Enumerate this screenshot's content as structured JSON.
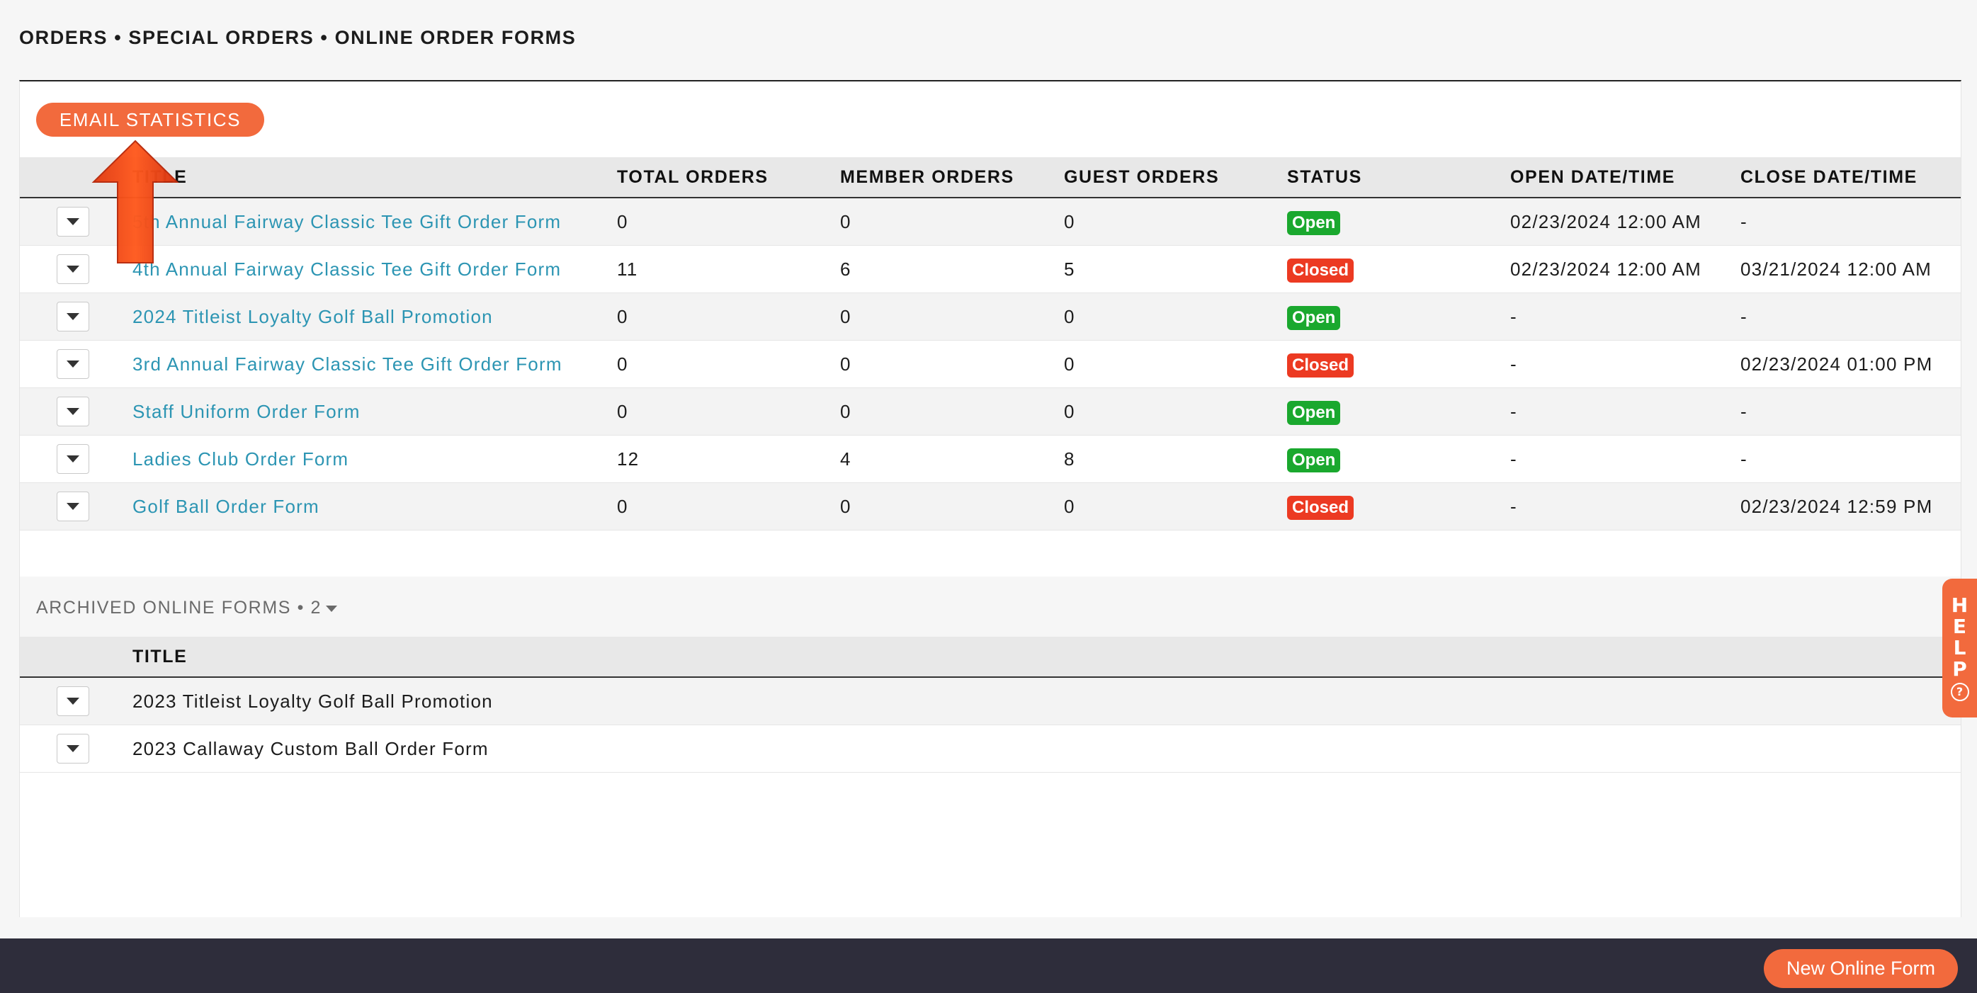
{
  "breadcrumb": "ORDERS • SPECIAL ORDERS • ONLINE ORDER FORMS",
  "email_stats_label": "EMAIL STATISTICS",
  "forms_table": {
    "headers": {
      "title": "TITLE",
      "total": "TOTAL ORDERS",
      "member": "MEMBER ORDERS",
      "guest": "GUEST ORDERS",
      "status": "STATUS",
      "open": "OPEN DATE/TIME",
      "close": "CLOSE DATE/TIME"
    },
    "rows": [
      {
        "title": "5th Annual Fairway Classic Tee Gift Order Form",
        "total": "0",
        "member": "0",
        "guest": "0",
        "status": "Open",
        "open": "02/23/2024 12:00 AM",
        "close": "-"
      },
      {
        "title": "4th Annual Fairway Classic Tee Gift Order Form",
        "total": "11",
        "member": "6",
        "guest": "5",
        "status": "Closed",
        "open": "02/23/2024 12:00 AM",
        "close": "03/21/2024 12:00 AM"
      },
      {
        "title": "2024 Titleist Loyalty Golf Ball Promotion",
        "total": "0",
        "member": "0",
        "guest": "0",
        "status": "Open",
        "open": "-",
        "close": "-"
      },
      {
        "title": "3rd Annual Fairway Classic Tee Gift Order Form",
        "total": "0",
        "member": "0",
        "guest": "0",
        "status": "Closed",
        "open": "-",
        "close": "02/23/2024 01:00 PM"
      },
      {
        "title": "Staff Uniform Order Form",
        "total": "0",
        "member": "0",
        "guest": "0",
        "status": "Open",
        "open": "-",
        "close": "-"
      },
      {
        "title": "Ladies Club Order Form",
        "total": "12",
        "member": "4",
        "guest": "8",
        "status": "Open",
        "open": "-",
        "close": "-"
      },
      {
        "title": "Golf Ball Order Form",
        "total": "0",
        "member": "0",
        "guest": "0",
        "status": "Closed",
        "open": "-",
        "close": "02/23/2024 12:59 PM"
      }
    ]
  },
  "archived": {
    "label": "ARCHIVED ONLINE FORMS • 2",
    "header_title": "TITLE",
    "rows": [
      {
        "title": "2023 Titleist Loyalty Golf Ball Promotion"
      },
      {
        "title": "2023 Callaway Custom Ball Order Form"
      }
    ]
  },
  "help_letters": [
    "H",
    "E",
    "L",
    "P"
  ],
  "help_icon": "?",
  "new_form_label": "New Online Form",
  "colors": {
    "accent": "#f26a3d",
    "link": "#2c95b3",
    "open": "#1aa82e",
    "closed": "#ec3a22",
    "footer": "#2e2d3b"
  }
}
